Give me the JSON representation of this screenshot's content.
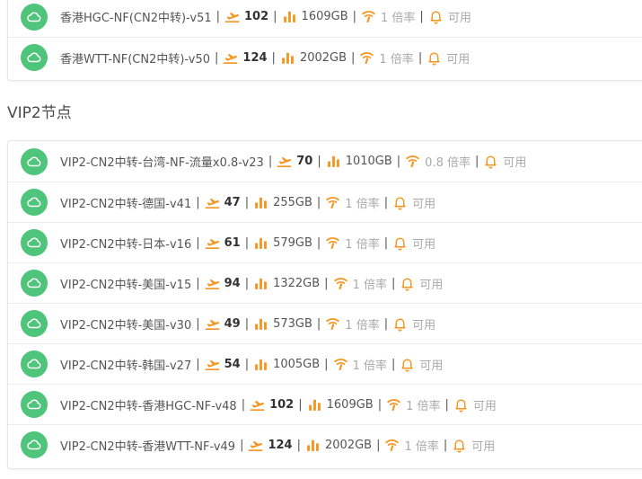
{
  "section_title": "VIP2节点",
  "top_rows": [
    {
      "name": "香港HGC-NF(CN2中转)-v51",
      "online": "102",
      "traffic": "1609GB",
      "ratio": "1 倍率",
      "status": "可用"
    },
    {
      "name": "香港WTT-NF(CN2中转)-v50",
      "online": "124",
      "traffic": "2002GB",
      "ratio": "1 倍率",
      "status": "可用"
    }
  ],
  "vip_rows": [
    {
      "name": "VIP2-CN2中转-台湾-NF-流量x0.8-v23",
      "online": "70",
      "traffic": "1010GB",
      "ratio": "0.8 倍率",
      "status": "可用"
    },
    {
      "name": "VIP2-CN2中转-德国-v41",
      "online": "47",
      "traffic": "255GB",
      "ratio": "1 倍率",
      "status": "可用"
    },
    {
      "name": "VIP2-CN2中转-日本-v16",
      "online": "61",
      "traffic": "579GB",
      "ratio": "1 倍率",
      "status": "可用"
    },
    {
      "name": "VIP2-CN2中转-美国-v15",
      "online": "94",
      "traffic": "1322GB",
      "ratio": "1 倍率",
      "status": "可用"
    },
    {
      "name": "VIP2-CN2中转-美国-v30",
      "online": "49",
      "traffic": "573GB",
      "ratio": "1 倍率",
      "status": "可用"
    },
    {
      "name": "VIP2-CN2中转-韩国-v27",
      "online": "54",
      "traffic": "1005GB",
      "ratio": "1 倍率",
      "status": "可用"
    },
    {
      "name": "VIP2-CN2中转-香港HGC-NF-v48",
      "online": "102",
      "traffic": "1609GB",
      "ratio": "1 倍率",
      "status": "可用"
    },
    {
      "name": "VIP2-CN2中转-香港WTT-NF-v49",
      "online": "124",
      "traffic": "2002GB",
      "ratio": "1 倍率",
      "status": "可用"
    }
  ],
  "separator": "|",
  "icons": {
    "node": "cloud-icon",
    "online": "plane-departure-icon",
    "traffic": "bar-chart-icon",
    "ratio": "wifi-signal-icon",
    "status": "bell-icon"
  },
  "colors": {
    "node_icon_bg": "#4fc47b",
    "accent": "#f7941d",
    "text": "#555555",
    "muted": "#a9a9a9"
  }
}
